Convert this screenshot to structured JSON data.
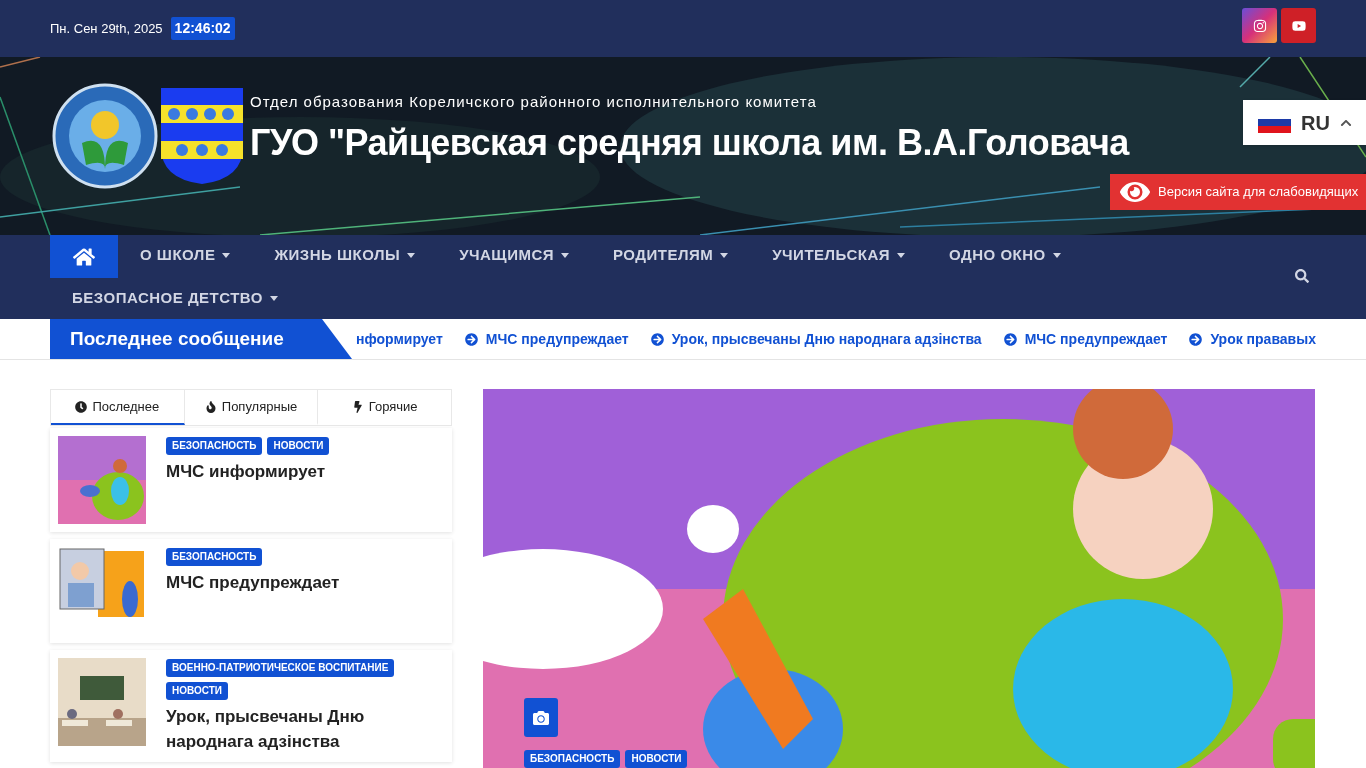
{
  "top_bar": {
    "date": "Пн. Сен 29th, 2025",
    "time": "12:46:02",
    "social": [
      {
        "kind": "instagram"
      },
      {
        "kind": "youtube"
      }
    ]
  },
  "header": {
    "subtitle": "Отдел образования Кореличского районного исполнительного комитета",
    "title": "ГУО \"Райцевская средняя школа им. В.А.Головача",
    "language": {
      "code": "RU",
      "expanded": true
    },
    "accessibility_button": "Версия сайта для слабовидящих"
  },
  "nav": {
    "items": [
      {
        "label": "О ШКОЛЕ"
      },
      {
        "label": "ЖИЗНЬ ШКОЛЫ"
      },
      {
        "label": "УЧАЩИМСЯ"
      },
      {
        "label": "РОДИТЕЛЯМ"
      },
      {
        "label": "УЧИТЕЛЬСКАЯ"
      },
      {
        "label": "ОДНО ОКНО"
      },
      {
        "label": "БЕЗОПАСНОЕ ДЕТСТВО"
      }
    ]
  },
  "ticker": {
    "label": "Последнее сообщение",
    "items": [
      {
        "text": "нформирует",
        "kind": "partial"
      },
      {
        "text": "МЧС предупреждает",
        "kind": "link"
      },
      {
        "text": "Урок, прысвечаны Дню народнага адзінства",
        "kind": "link"
      },
      {
        "text": "МЧС предупреждает",
        "kind": "link"
      },
      {
        "text": "Урок прававых",
        "kind": "link"
      }
    ]
  },
  "tabs": [
    {
      "label": "Последнее",
      "selected": true
    },
    {
      "label": "Популярные",
      "selected": false
    },
    {
      "label": "Горячие",
      "selected": false
    }
  ],
  "posts": [
    {
      "tags": [
        "БЕЗОПАСНОСТЬ",
        "НОВОСТИ"
      ],
      "title": "МЧС информирует"
    },
    {
      "tags": [
        "БЕЗОПАСНОСТЬ"
      ],
      "title": "МЧС предупреждает"
    },
    {
      "tags": [
        "ВОЕННО-ПАТРИОТИЧЕСКОЕ ВОСПИТАНИЕ",
        "НОВОСТИ"
      ],
      "title": "Урок, прысвечаны Дню народнага адзінства"
    }
  ],
  "featured": {
    "kind": "picture",
    "tags": [
      "БЕЗОПАСНОСТЬ",
      "НОВОСТИ"
    ]
  }
}
